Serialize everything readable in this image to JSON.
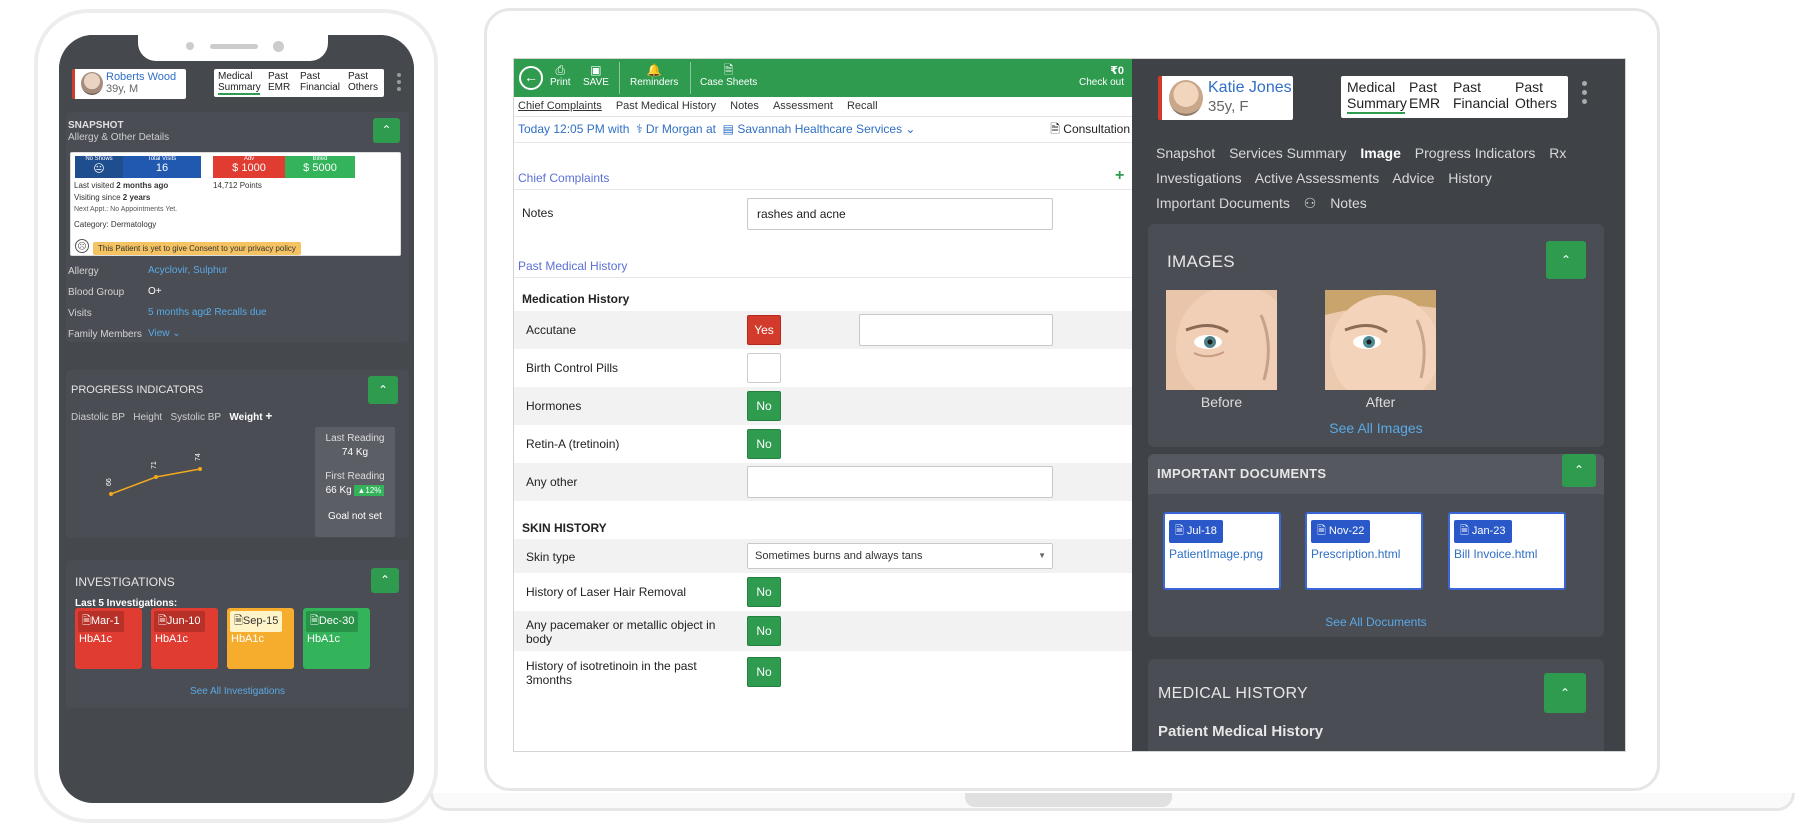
{
  "form": {
    "toolbar": {
      "back_icon": "arrow-left-icon",
      "print": "Print",
      "save": "SAVE",
      "reminders": "Reminders",
      "case_sheets": "Case Sheets",
      "amount": "₹0",
      "checkout": "Check out"
    },
    "subtabs": [
      "Chief Complaints",
      "Past Medical History",
      "Notes",
      "Assessment",
      "Recall"
    ],
    "visit": {
      "time": "Today 12:05 PM with",
      "doctor": "Dr Morgan at",
      "clinic": "Savannah Healthcare Services",
      "consultation": "Consultation"
    },
    "chief_complaints_title": "Chief Complaints",
    "notes_label": "Notes",
    "notes_value": "rashes and acne",
    "pmh_title": "Past Medical History",
    "medication_history_title": "Medication History",
    "medications": [
      {
        "label": "Accutane",
        "answer": "Yes"
      },
      {
        "label": "Birth Control Pills",
        "answer": ""
      },
      {
        "label": "Hormones",
        "answer": "No"
      },
      {
        "label": "Retin-A (tretinoin)",
        "answer": "No"
      },
      {
        "label": "Any other",
        "answer": ""
      }
    ],
    "skin_history_title": "SKIN HISTORY",
    "skin_type_label": "Skin type",
    "skin_type_value": "Sometimes burns and always tans",
    "skin_rows": [
      {
        "label": "History of Laser Hair Removal",
        "answer": "No"
      },
      {
        "label": "Any pacemaker or metallic object in body",
        "answer": "No"
      },
      {
        "label": "History of isotretinoin in the past 3months",
        "answer": "No"
      }
    ]
  },
  "patient": {
    "name": "Katie Jones",
    "info": "35y, F",
    "tabs": [
      {
        "label": "Medical Summary",
        "active": true
      },
      {
        "label": "Past EMR",
        "active": false
      },
      {
        "label": "Past Financial",
        "active": false
      },
      {
        "label": "Past Others",
        "active": false
      }
    ],
    "nav": [
      "Snapshot",
      "Services Summary",
      "Image",
      "Progress Indicators",
      "Rx",
      "Investigations",
      "Active Assessments",
      "Advice",
      "History",
      "Important Documents",
      "Notes"
    ],
    "nav_active": "Image",
    "images_title": "IMAGES",
    "images": [
      {
        "caption": "Before"
      },
      {
        "caption": "After"
      }
    ],
    "see_all_images": "See All Images",
    "documents_title": "IMPORTANT DOCUMENTS",
    "documents": [
      {
        "date": "Jul-18",
        "name": "PatientImage.png"
      },
      {
        "date": "Nov-22",
        "name": "Prescription.html"
      },
      {
        "date": "Jan-23",
        "name": "Bill Invoice.html"
      }
    ],
    "see_all_documents": "See All Documents",
    "medical_history_title": "MEDICAL HISTORY",
    "patient_medical_history": "Patient Medical History"
  },
  "phone": {
    "patient_name": "Roberts Wood",
    "patient_info": "39y, M",
    "tabs": [
      "Medical Summary",
      "Past EMR",
      "Past Financial",
      "Past Others"
    ],
    "snapshot_title": "SNAPSHOT",
    "snapshot_subtitle": "Allergy & Other Details",
    "no_shows_label": "No Shows",
    "no_shows_value": "😐",
    "total_visits_label": "Total Visits",
    "total_visits_value": "16",
    "adv_label": "Adv",
    "adv_value": "$ 1000",
    "billed_label": "Billed",
    "billed_value": "$ 5000",
    "last_visited_prefix": "Last visited",
    "last_visited": "2 months ago",
    "visiting_prefix": "Visiting since",
    "visiting_since": "2 years",
    "points": "14,712 Points",
    "next_appt": "Next Appt.: No Appointments Yet.",
    "category_prefix": "Category:",
    "category": "Dermatology",
    "consent": "This Patient is yet to give Consent to your privacy policy",
    "allergy_label": "Allergy",
    "allergy_value": "Acyclovir, Sulphur",
    "blood_label": "Blood Group",
    "blood_value": "O+",
    "visits_label": "Visits",
    "visits_value": "5 months ago",
    "recalls_value": "2 Recalls due",
    "family_label": "Family Members",
    "family_value": "View",
    "progress_title": "PROGRESS INDICATORS",
    "progress_tabs": [
      "Diastolic BP",
      "Height",
      "Systolic BP",
      "Weight"
    ],
    "progress_active": "Weight",
    "last_reading_label": "Last Reading",
    "last_reading_value": "74 Kg",
    "first_reading_label": "First Reading",
    "first_reading_value": "66 Kg",
    "change": "▲12%",
    "goal": "Goal not set",
    "chart_labels": [
      "66",
      "71",
      "74"
    ],
    "investigations_title": "INVESTIGATIONS",
    "last5": "Last 5 Investigations:",
    "investigations": [
      {
        "date": "Mar-1",
        "name": "HbA1c",
        "color": "#e03c31"
      },
      {
        "date": "Jun-10",
        "name": "HbA1c",
        "color": "#e03c31"
      },
      {
        "date": "Sep-15",
        "name": "HbA1c",
        "color": "#f6ad2e"
      },
      {
        "date": "Dec-30",
        "name": "HbA1c",
        "color": "#33b35a"
      }
    ],
    "see_all_investigations": "See All Investigations"
  }
}
